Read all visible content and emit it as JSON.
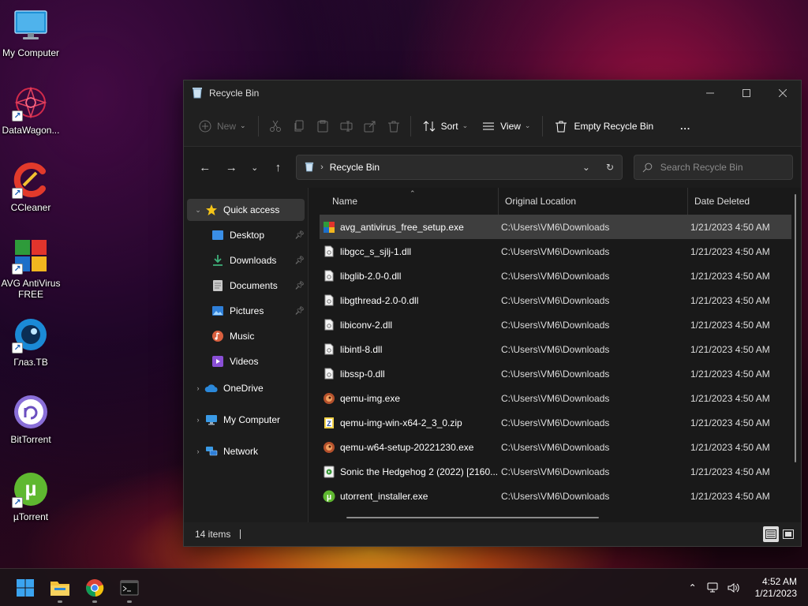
{
  "desktop": {
    "icons": [
      {
        "label": "My Computer"
      },
      {
        "label": "DataWagon..."
      },
      {
        "label": "CCleaner"
      },
      {
        "label": "AVG AntiVirus FREE"
      },
      {
        "label": "Глаз.ТВ"
      },
      {
        "label": "BitTorrent"
      },
      {
        "label": "µTorrent"
      }
    ]
  },
  "window": {
    "title": "Recycle Bin",
    "toolbar": {
      "new_label": "New",
      "sort_label": "Sort",
      "view_label": "View",
      "empty_label": "Empty Recycle Bin",
      "more_label": "..."
    },
    "address": {
      "crumb": "Recycle Bin",
      "separator": "›"
    },
    "search": {
      "placeholder": "Search Recycle Bin"
    },
    "sidebar": {
      "quick_access": "Quick access",
      "items": [
        {
          "label": "Desktop"
        },
        {
          "label": "Downloads"
        },
        {
          "label": "Documents"
        },
        {
          "label": "Pictures"
        },
        {
          "label": "Music"
        },
        {
          "label": "Videos"
        }
      ],
      "onedrive": "OneDrive",
      "my_computer": "My Computer",
      "network": "Network"
    },
    "columns": {
      "name": "Name",
      "location": "Original Location",
      "date": "Date Deleted"
    },
    "files": [
      {
        "name": "avg_antivirus_free_setup.exe",
        "location": "C:\\Users\\VM6\\Downloads",
        "date": "1/21/2023 4:50 AM"
      },
      {
        "name": "libgcc_s_sjlj-1.dll",
        "location": "C:\\Users\\VM6\\Downloads",
        "date": "1/21/2023 4:50 AM"
      },
      {
        "name": "libglib-2.0-0.dll",
        "location": "C:\\Users\\VM6\\Downloads",
        "date": "1/21/2023 4:50 AM"
      },
      {
        "name": "libgthread-2.0-0.dll",
        "location": "C:\\Users\\VM6\\Downloads",
        "date": "1/21/2023 4:50 AM"
      },
      {
        "name": "libiconv-2.dll",
        "location": "C:\\Users\\VM6\\Downloads",
        "date": "1/21/2023 4:50 AM"
      },
      {
        "name": "libintl-8.dll",
        "location": "C:\\Users\\VM6\\Downloads",
        "date": "1/21/2023 4:50 AM"
      },
      {
        "name": "libssp-0.dll",
        "location": "C:\\Users\\VM6\\Downloads",
        "date": "1/21/2023 4:50 AM"
      },
      {
        "name": "qemu-img.exe",
        "location": "C:\\Users\\VM6\\Downloads",
        "date": "1/21/2023 4:50 AM"
      },
      {
        "name": "qemu-img-win-x64-2_3_0.zip",
        "location": "C:\\Users\\VM6\\Downloads",
        "date": "1/21/2023 4:50 AM"
      },
      {
        "name": "qemu-w64-setup-20221230.exe",
        "location": "C:\\Users\\VM6\\Downloads",
        "date": "1/21/2023 4:50 AM"
      },
      {
        "name": "Sonic the Hedgehog 2 (2022) [2160...",
        "location": "C:\\Users\\VM6\\Downloads",
        "date": "1/21/2023 4:50 AM"
      },
      {
        "name": "utorrent_installer.exe",
        "location": "C:\\Users\\VM6\\Downloads",
        "date": "1/21/2023 4:50 AM"
      }
    ],
    "status": {
      "item_count": "14 items"
    }
  },
  "taskbar": {
    "time": "4:52 AM",
    "date": "1/21/2023"
  },
  "colors": {
    "window_bg": "#202020",
    "selected_row": "#3e3e3e",
    "accent_blue": "#0078d4"
  }
}
